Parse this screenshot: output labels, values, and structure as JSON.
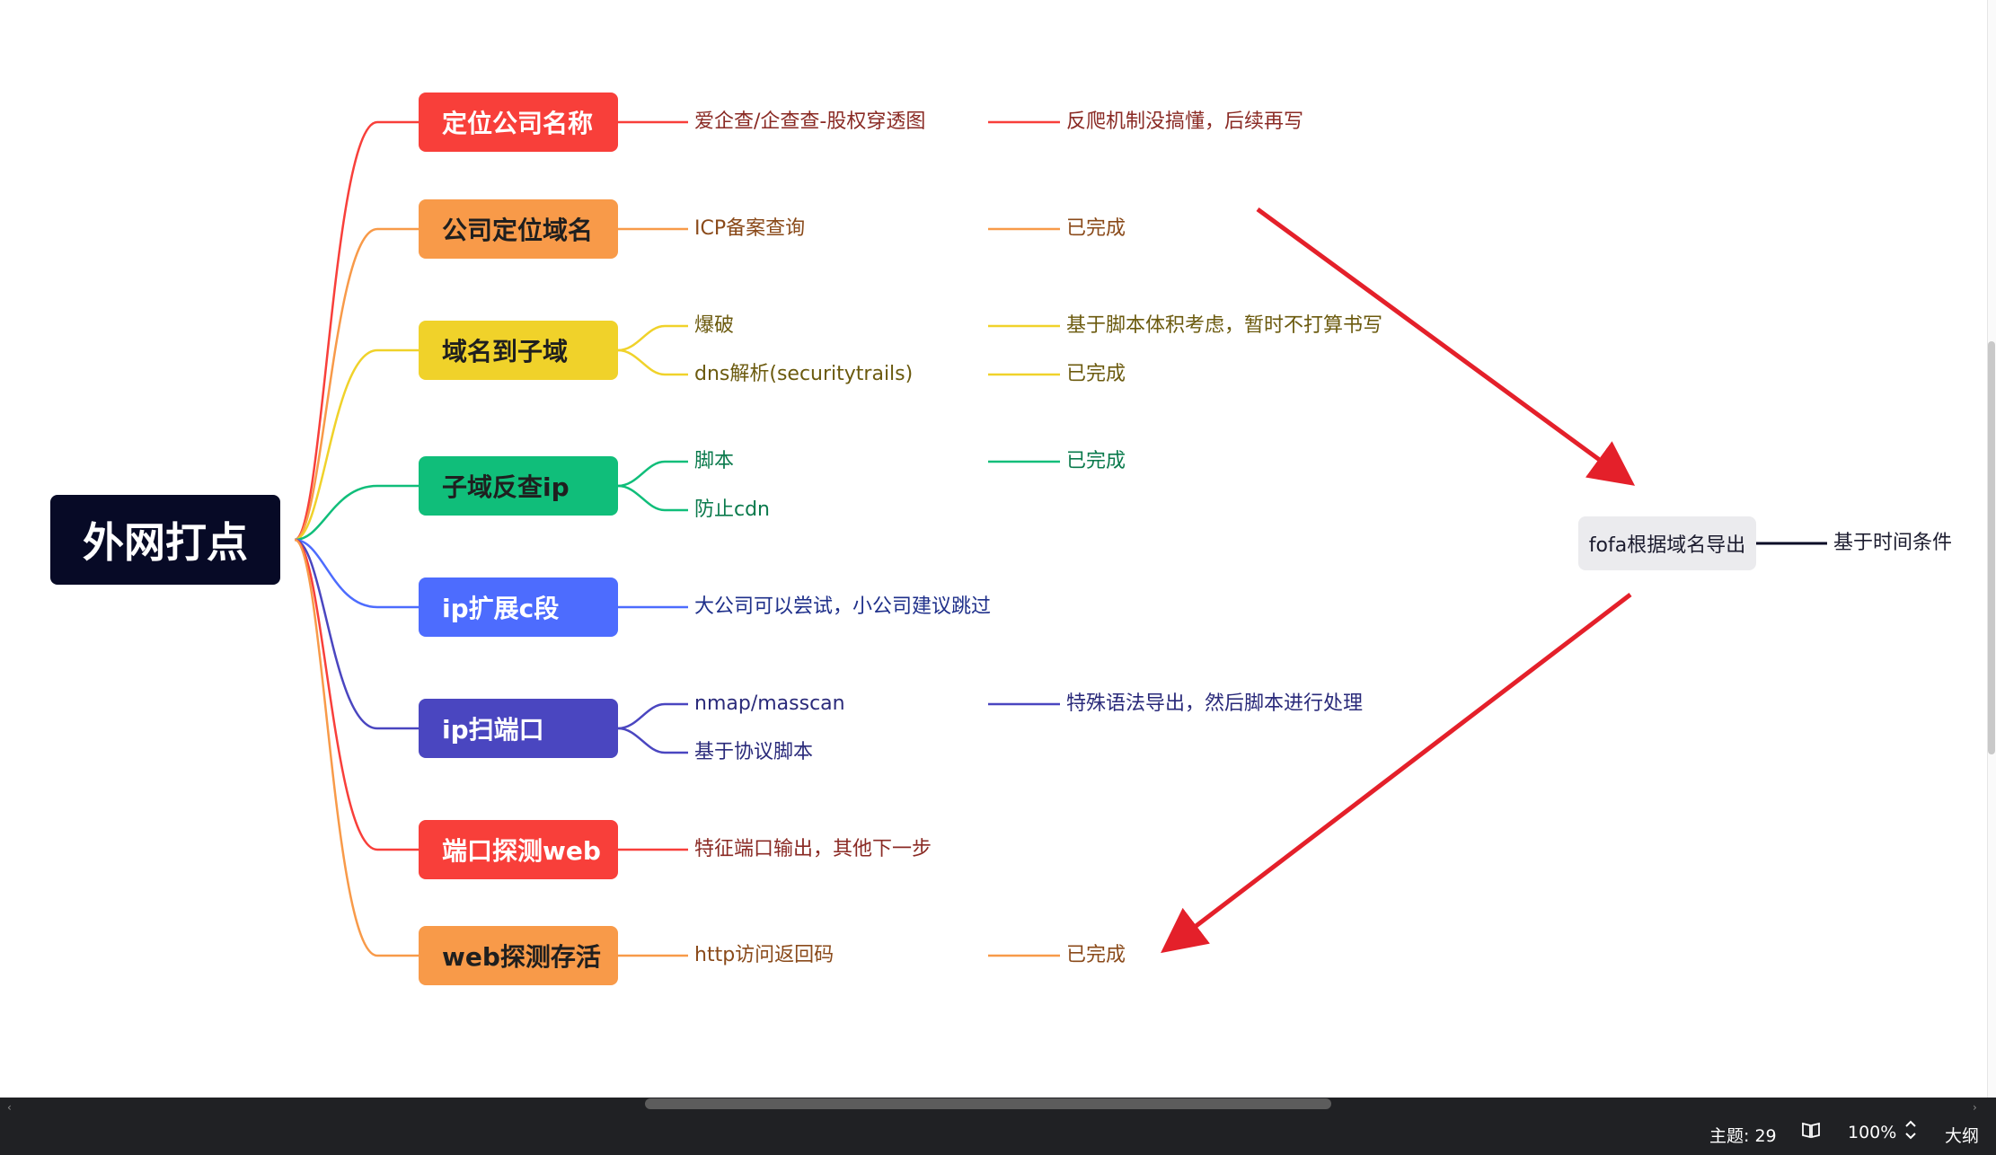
{
  "root": {
    "label": "外网打点"
  },
  "branches": [
    {
      "label": "定位公司名称",
      "color": "#f83f3a",
      "text_color": "#ffffff"
    },
    {
      "label": "公司定位域名",
      "color": "#f89a49",
      "text_color": "#1f1f1f"
    },
    {
      "label": "域名到子域",
      "color": "#f0d22a",
      "text_color": "#1f1f1f"
    },
    {
      "label": "子域反查ip",
      "color": "#10be7a",
      "text_color": "#1f1f1f"
    },
    {
      "label": "ip扩展c段",
      "color": "#4d6cfe",
      "text_color": "#ffffff"
    },
    {
      "label": "ip扫端口",
      "color": "#4a46c0",
      "text_color": "#ffffff"
    },
    {
      "label": "端口探测web",
      "color": "#f83f3a",
      "text_color": "#ffffff"
    },
    {
      "label": "web探测存活",
      "color": "#f89a49",
      "text_color": "#1f1f1f"
    }
  ],
  "leaves": {
    "b0_l0": "爱企查/企查查-股权穿透图",
    "b0_l0_note": "反爬机制没搞懂，后续再写",
    "b1_l0": "ICP备案查询",
    "b1_l0_note": "已完成",
    "b2_l0": "爆破",
    "b2_l0_note": "基于脚本体积考虑，暂时不打算书写",
    "b2_l1": "dns解析(securitytrails)",
    "b2_l1_note": "已完成",
    "b3_l0": "脚本",
    "b3_l0_note": "已完成",
    "b3_l1": "防止cdn",
    "b4_l0": "大公司可以尝试，小公司建议跳过",
    "b5_l0": "nmap/masscan",
    "b5_l0_note": "特殊语法导出，然后脚本进行处理",
    "b5_l1": "基于协议脚本",
    "b6_l0": "特征端口输出，其他下一步",
    "b7_l0": "http访问返回码",
    "b7_l0_note": "已完成"
  },
  "floating": {
    "label": "fofa根据域名导出",
    "child": "基于时间条件",
    "arrow_color": "#e4202a"
  },
  "statusbar": {
    "topics_label": "主题: 29",
    "zoom": "100%",
    "outline": "大纲"
  },
  "icons": [
    "book-icon",
    "chevron-updown-icon",
    "scroll-left-icon",
    "scroll-right-icon"
  ]
}
